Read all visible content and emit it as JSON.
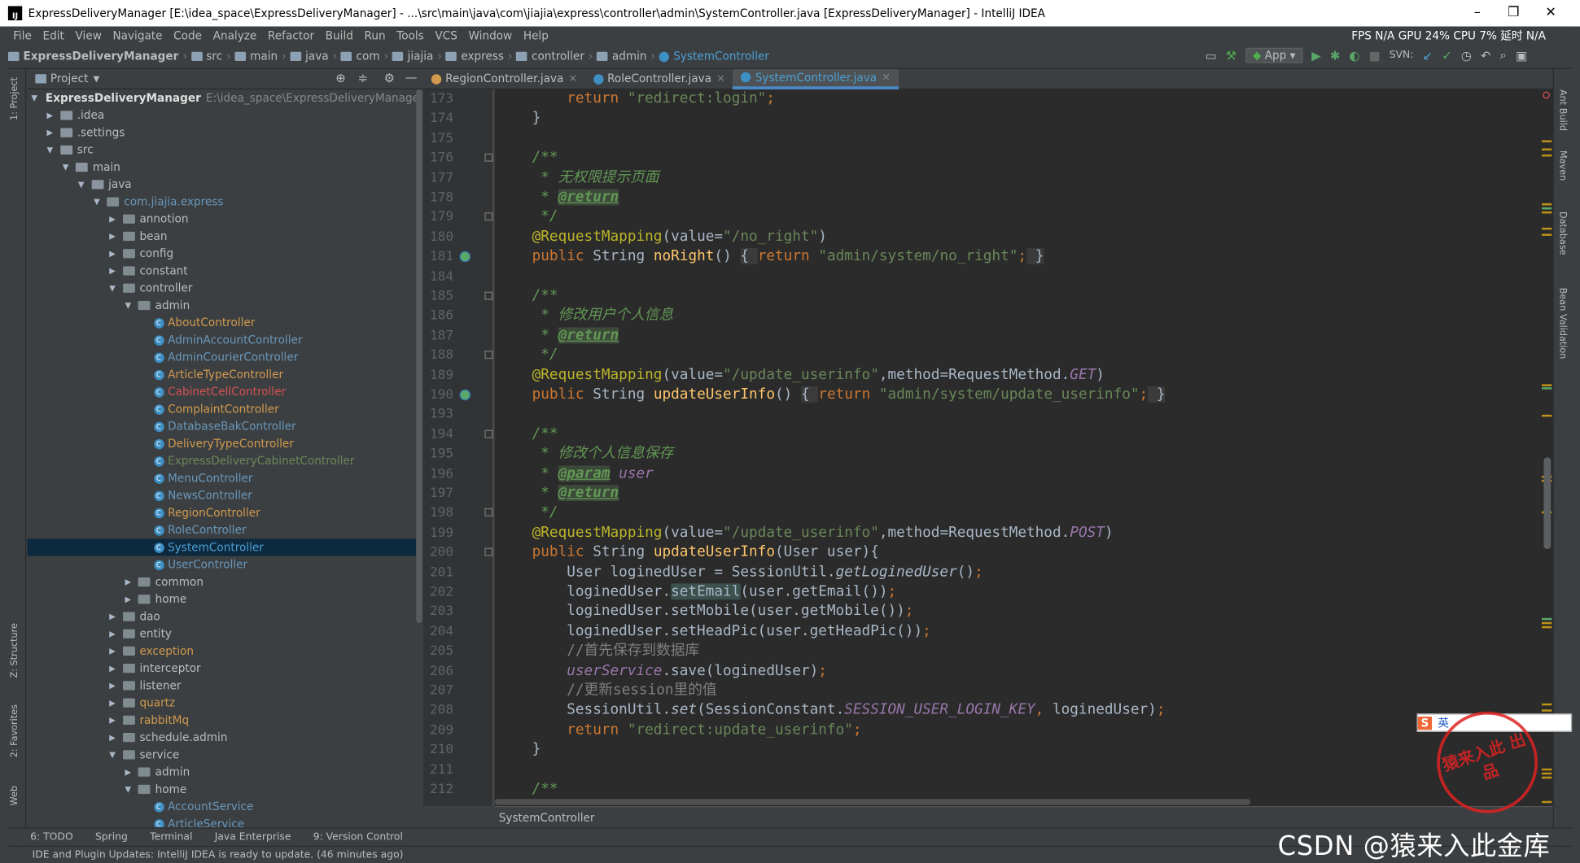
{
  "window": {
    "title": "ExpressDeliveryManager [E:\\idea_space\\ExpressDeliveryManager] - ...\\src\\main\\java\\com\\jiajia\\express\\controller\\admin\\SystemController.java [ExpressDeliveryManager] - IntelliJ IDEA",
    "app_icon": "IJ"
  },
  "menu": [
    "File",
    "Edit",
    "View",
    "Navigate",
    "Code",
    "Analyze",
    "Refactor",
    "Build",
    "Run",
    "Tools",
    "VCS",
    "Window",
    "Help"
  ],
  "system_stats": "FPS N/A GPU 24% CPU 7% 延时 N/A",
  "breadcrumbs": [
    "ExpressDeliveryManager",
    "src",
    "main",
    "java",
    "com",
    "jiajia",
    "express",
    "controller",
    "admin",
    "SystemController"
  ],
  "toolbar": {
    "run_config": "App",
    "svn_label": "SVN:"
  },
  "left_strip": {
    "project": "1: Project",
    "structure": "Z: Structure",
    "favorites": "2: Favorites",
    "web": "Web"
  },
  "right_strip": [
    "Ant Build",
    "Maven",
    "Database",
    "Bean Validation"
  ],
  "project_panel": {
    "title": "Project"
  },
  "tree": [
    {
      "label": "ExpressDeliveryManager",
      "extra": "E:\\idea_space\\ExpressDeliveryManager",
      "depth": 0,
      "arrow": "down",
      "kind": "folder",
      "bold": true
    },
    {
      "label": ".idea",
      "depth": 1,
      "arrow": "right",
      "kind": "folder"
    },
    {
      "label": ".settings",
      "depth": 1,
      "arrow": "right",
      "kind": "folder"
    },
    {
      "label": "src",
      "depth": 1,
      "arrow": "down",
      "kind": "folder"
    },
    {
      "label": "main",
      "depth": 2,
      "arrow": "down",
      "kind": "folder"
    },
    {
      "label": "java",
      "depth": 3,
      "arrow": "down",
      "kind": "folder"
    },
    {
      "label": "com.jiajia.express",
      "depth": 4,
      "arrow": "down",
      "kind": "package",
      "color": "#6897bb"
    },
    {
      "label": "annotion",
      "depth": 5,
      "arrow": "right",
      "kind": "package"
    },
    {
      "label": "bean",
      "depth": 5,
      "arrow": "right",
      "kind": "package"
    },
    {
      "label": "config",
      "depth": 5,
      "arrow": "right",
      "kind": "package"
    },
    {
      "label": "constant",
      "depth": 5,
      "arrow": "right",
      "kind": "package"
    },
    {
      "label": "controller",
      "depth": 5,
      "arrow": "down",
      "kind": "package"
    },
    {
      "label": "admin",
      "depth": 6,
      "arrow": "down",
      "kind": "package"
    },
    {
      "label": "AboutController",
      "depth": 7,
      "kind": "class",
      "color": "#d19a4f"
    },
    {
      "label": "AdminAccountController",
      "depth": 7,
      "kind": "class",
      "color": "#6897bb"
    },
    {
      "label": "AdminCourierController",
      "depth": 7,
      "kind": "class",
      "color": "#6897bb"
    },
    {
      "label": "ArticleTypeController",
      "depth": 7,
      "kind": "class",
      "color": "#d19a4f"
    },
    {
      "label": "CabinetCellController",
      "depth": 7,
      "kind": "class",
      "color": "#d25252"
    },
    {
      "label": "ComplaintController",
      "depth": 7,
      "kind": "class",
      "color": "#d19a4f"
    },
    {
      "label": "DatabaseBakController",
      "depth": 7,
      "kind": "class",
      "color": "#6897bb"
    },
    {
      "label": "DeliveryTypeController",
      "depth": 7,
      "kind": "class",
      "color": "#d19a4f"
    },
    {
      "label": "ExpressDeliveryCabinetController",
      "depth": 7,
      "kind": "class",
      "color": "#6a8759"
    },
    {
      "label": "MenuController",
      "depth": 7,
      "kind": "class",
      "color": "#6897bb"
    },
    {
      "label": "NewsController",
      "depth": 7,
      "kind": "class",
      "color": "#6897bb"
    },
    {
      "label": "RegionController",
      "depth": 7,
      "kind": "class",
      "color": "#d19a4f"
    },
    {
      "label": "RoleController",
      "depth": 7,
      "kind": "class",
      "color": "#6897bb"
    },
    {
      "label": "SystemController",
      "depth": 7,
      "kind": "class",
      "color": "#6897bb",
      "selected": true
    },
    {
      "label": "UserController",
      "depth": 7,
      "kind": "class",
      "color": "#6897bb"
    },
    {
      "label": "common",
      "depth": 6,
      "arrow": "right",
      "kind": "package"
    },
    {
      "label": "home",
      "depth": 6,
      "arrow": "right",
      "kind": "package"
    },
    {
      "label": "dao",
      "depth": 5,
      "arrow": "right",
      "kind": "package"
    },
    {
      "label": "entity",
      "depth": 5,
      "arrow": "right",
      "kind": "package"
    },
    {
      "label": "exception",
      "depth": 5,
      "arrow": "right",
      "kind": "package",
      "color": "#d19a4f"
    },
    {
      "label": "interceptor",
      "depth": 5,
      "arrow": "right",
      "kind": "package"
    },
    {
      "label": "listener",
      "depth": 5,
      "arrow": "right",
      "kind": "package"
    },
    {
      "label": "quartz",
      "depth": 5,
      "arrow": "right",
      "kind": "package",
      "color": "#d19a4f"
    },
    {
      "label": "rabbitMq",
      "depth": 5,
      "arrow": "right",
      "kind": "package",
      "color": "#d19a4f"
    },
    {
      "label": "schedule.admin",
      "depth": 5,
      "arrow": "right",
      "kind": "package"
    },
    {
      "label": "service",
      "depth": 5,
      "arrow": "down",
      "kind": "package"
    },
    {
      "label": "admin",
      "depth": 6,
      "arrow": "right",
      "kind": "package"
    },
    {
      "label": "home",
      "depth": 6,
      "arrow": "down",
      "kind": "package"
    },
    {
      "label": "AccountService",
      "depth": 7,
      "kind": "class",
      "color": "#6897bb"
    },
    {
      "label": "ArticleService",
      "depth": 7,
      "kind": "class",
      "color": "#6897bb"
    }
  ],
  "tabs": [
    {
      "label": "RegionController.java",
      "active": false
    },
    {
      "label": "RoleController.java",
      "active": false
    },
    {
      "label": "SystemController.java",
      "active": true
    }
  ],
  "line_numbers": [
    "173",
    "174",
    "175",
    "176",
    "177",
    "178",
    "179",
    "180",
    "181",
    "184",
    "185",
    "186",
    "187",
    "188",
    "189",
    "190",
    "193",
    "194",
    "195",
    "196",
    "197",
    "198",
    "199",
    "200",
    "201",
    "202",
    "203",
    "204",
    "205",
    "206",
    "207",
    "208",
    "209",
    "210",
    "211",
    "212"
  ],
  "code_lines": [
    [
      {
        "t": "    "
      },
      {
        "t": "return ",
        "c": "kw"
      },
      {
        "t": "\"redirect:login\"",
        "c": "st"
      },
      {
        "t": ";",
        "c": "kw"
      }
    ],
    [
      {
        "t": "}"
      }
    ],
    [
      {
        "t": ""
      }
    ],
    [
      {
        "t": "/**",
        "c": "cm"
      }
    ],
    [
      {
        "t": " * ",
        "c": "cm"
      },
      {
        "t": "无权限提示页面",
        "c": "cmz"
      }
    ],
    [
      {
        "t": " * ",
        "c": "cm"
      },
      {
        "t": "@return",
        "c": "tag"
      }
    ],
    [
      {
        "t": " */",
        "c": "cm"
      }
    ],
    [
      {
        "t": "@RequestMapping",
        "c": "an"
      },
      {
        "t": "(value="
      },
      {
        "t": "\"/no_right\"",
        "c": "st"
      },
      {
        "t": ")"
      }
    ],
    [
      {
        "t": "public ",
        "c": "kw"
      },
      {
        "t": "String "
      },
      {
        "t": "noRight",
        "c": "fn"
      },
      {
        "t": "() "
      },
      {
        "t": "{ ",
        "c": "fold"
      },
      {
        "t": "return ",
        "c": "kw"
      },
      {
        "t": "\"admin/system/no_right\"",
        "c": "st"
      },
      {
        "t": ";",
        "c": "kw"
      },
      {
        "t": " }",
        "c": "fold"
      }
    ],
    [
      {
        "t": ""
      }
    ],
    [
      {
        "t": "/**",
        "c": "cm"
      }
    ],
    [
      {
        "t": " * ",
        "c": "cm"
      },
      {
        "t": "修改用户个人信息",
        "c": "cmz"
      }
    ],
    [
      {
        "t": " * ",
        "c": "cm"
      },
      {
        "t": "@return",
        "c": "tag"
      }
    ],
    [
      {
        "t": " */",
        "c": "cm"
      }
    ],
    [
      {
        "t": "@RequestMapping",
        "c": "an"
      },
      {
        "t": "(value="
      },
      {
        "t": "\"/update_userinfo\"",
        "c": "st"
      },
      {
        "t": ",method=RequestMethod."
      },
      {
        "t": "GET",
        "c": "pv"
      },
      {
        "t": ")"
      }
    ],
    [
      {
        "t": "public ",
        "c": "kw"
      },
      {
        "t": "String "
      },
      {
        "t": "updateUserInfo",
        "c": "fn"
      },
      {
        "t": "() "
      },
      {
        "t": "{ ",
        "c": "fold"
      },
      {
        "t": "return ",
        "c": "kw"
      },
      {
        "t": "\"admin/system/update_userinfo\"",
        "c": "st"
      },
      {
        "t": ";",
        "c": "kw"
      },
      {
        "t": " }",
        "c": "fold"
      }
    ],
    [
      {
        "t": ""
      }
    ],
    [
      {
        "t": "/**",
        "c": "cm"
      }
    ],
    [
      {
        "t": " * ",
        "c": "cm"
      },
      {
        "t": "修改个人信息保存",
        "c": "cmz"
      }
    ],
    [
      {
        "t": " * ",
        "c": "cm"
      },
      {
        "t": "@param",
        "c": "tag"
      },
      {
        "t": " ",
        "c": "cm"
      },
      {
        "t": "user",
        "c": "pv"
      }
    ],
    [
      {
        "t": " * ",
        "c": "cm"
      },
      {
        "t": "@return",
        "c": "tag"
      }
    ],
    [
      {
        "t": " */",
        "c": "cm"
      }
    ],
    [
      {
        "t": "@RequestMapping",
        "c": "an"
      },
      {
        "t": "(value="
      },
      {
        "t": "\"/update_userinfo\"",
        "c": "st"
      },
      {
        "t": ",method=RequestMethod."
      },
      {
        "t": "POST",
        "c": "pv"
      },
      {
        "t": ")"
      }
    ],
    [
      {
        "t": "public ",
        "c": "kw"
      },
      {
        "t": "String "
      },
      {
        "t": "updateUserInfo",
        "c": "fn"
      },
      {
        "t": "(User user){"
      }
    ],
    [
      {
        "t": "    User logined"
      },
      {
        "t": "User = SessionUtil."
      },
      {
        "t": "getLoginedUser",
        "c": "it"
      },
      {
        "t": "()"
      },
      {
        "t": ";",
        "c": "kw"
      }
    ],
    [
      {
        "t": "    loginedUser."
      },
      {
        "t": "setEmail",
        "c": "hl"
      },
      {
        "t": "(user.getEmail())"
      },
      {
        "t": ";",
        "c": "kw"
      }
    ],
    [
      {
        "t": "    loginedUser.setMobile(user.getMobile())"
      },
      {
        "t": ";",
        "c": "kw"
      }
    ],
    [
      {
        "t": "    loginedUser.setHeadPic(user.getHeadPic())"
      },
      {
        "t": ";",
        "c": "kw"
      }
    ],
    [
      {
        "t": "    "
      },
      {
        "t": "//首先保存到数据库",
        "c": "lc"
      }
    ],
    [
      {
        "t": "    "
      },
      {
        "t": "userService",
        "c": "pv"
      },
      {
        "t": ".save(loginedUser)"
      },
      {
        "t": ";",
        "c": "kw"
      }
    ],
    [
      {
        "t": "    "
      },
      {
        "t": "//更新session里的值",
        "c": "lc"
      }
    ],
    [
      {
        "t": "    SessionUtil."
      },
      {
        "t": "set",
        "c": "it"
      },
      {
        "t": "(SessionConstant."
      },
      {
        "t": "SESSION_USER_LOGIN_KEY",
        "c": "pv"
      },
      {
        "t": ", ",
        "c": "kw"
      },
      {
        "t": "loginedUser)"
      },
      {
        "t": ";",
        "c": "kw"
      }
    ],
    [
      {
        "t": "    "
      },
      {
        "t": "return ",
        "c": "kw"
      },
      {
        "t": "\"redirect:update_userinfo\"",
        "c": "st"
      },
      {
        "t": ";",
        "c": "kw"
      }
    ],
    [
      {
        "t": "}"
      }
    ],
    [
      {
        "t": ""
      }
    ],
    [
      {
        "t": "/**",
        "c": "cm"
      }
    ]
  ],
  "editor_breadcrumb": "SystemController",
  "tool_windows": [
    "6: TODO",
    "Spring",
    "Terminal",
    "Java Enterprise",
    "9: Version Control"
  ],
  "status_message": "IDE and Plugin Updates: IntelliJ IDEA is ready to update. (46 minutes ago)",
  "ime": {
    "label": "英"
  },
  "watermark": {
    "csdn": "CSDN @猿来入此金库",
    "stamp": "猿来入此 出品"
  }
}
